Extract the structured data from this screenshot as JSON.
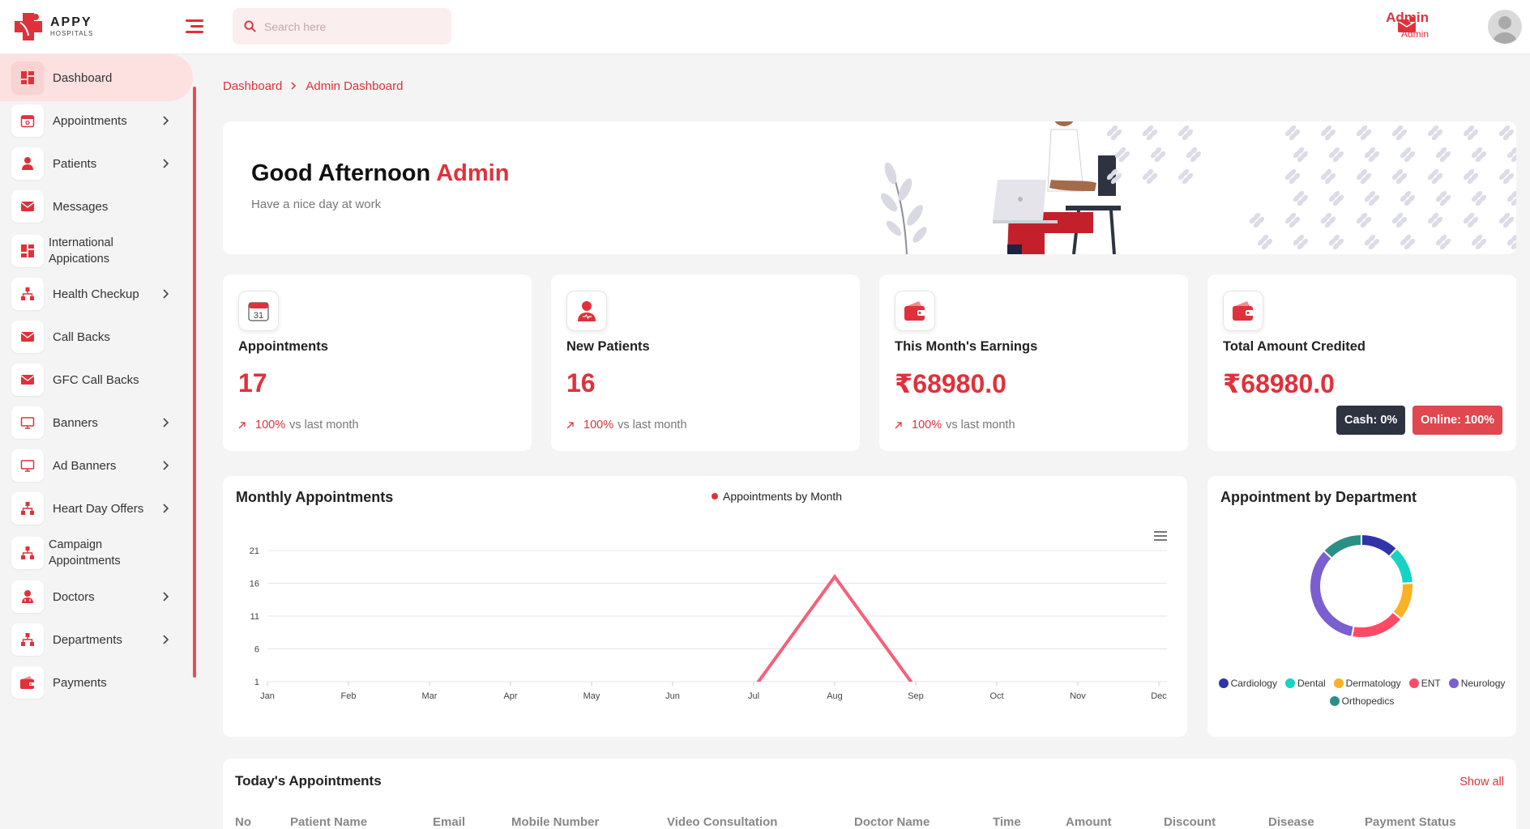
{
  "brand": {
    "name": "APPY",
    "sub": "HOSPITALS",
    "accent": "#e0313a"
  },
  "search": {
    "placeholder": "Search here"
  },
  "user": {
    "name": "Admin",
    "role": "Admin"
  },
  "sidebar": {
    "items": [
      {
        "label": "Dashboard",
        "icon": "dashboard-icon",
        "chevron": false,
        "active": true
      },
      {
        "label": "Appointments",
        "icon": "calendar-icon",
        "chevron": true
      },
      {
        "label": "Patients",
        "icon": "patient-icon",
        "chevron": true
      },
      {
        "label": "Messages",
        "icon": "mail-icon",
        "chevron": false
      },
      {
        "label": "International Appications",
        "icon": "grid-icon",
        "chevron": false
      },
      {
        "label": "Health Checkup",
        "icon": "sitemap-icon",
        "chevron": true
      },
      {
        "label": "Call Backs",
        "icon": "mail-icon",
        "chevron": false
      },
      {
        "label": "GFC Call Backs",
        "icon": "mail-icon",
        "chevron": false
      },
      {
        "label": "Banners",
        "icon": "monitor-icon",
        "chevron": true
      },
      {
        "label": "Ad Banners",
        "icon": "monitor-icon",
        "chevron": true
      },
      {
        "label": "Heart Day Offers",
        "icon": "sitemap-icon",
        "chevron": true
      },
      {
        "label": "Campaign Appointments",
        "icon": "sitemap-icon",
        "chevron": false
      },
      {
        "label": "Doctors",
        "icon": "doctor-icon",
        "chevron": true
      },
      {
        "label": "Departments",
        "icon": "sitemap-icon",
        "chevron": true
      },
      {
        "label": "Payments",
        "icon": "wallet-icon",
        "chevron": false
      }
    ]
  },
  "breadcrumb": {
    "root": "Dashboard",
    "current": "Admin Dashboard"
  },
  "welcome": {
    "greeting": "Good Afternoon",
    "name": "Admin",
    "subtitle": "Have a nice day at work"
  },
  "stats": [
    {
      "title": "Appointments",
      "value": "17",
      "trend_pct": "100%",
      "trend_text": "vs last month",
      "icon": "calendar-icon"
    },
    {
      "title": "New Patients",
      "value": "16",
      "trend_pct": "100%",
      "trend_text": "vs last month",
      "icon": "patient-icon"
    },
    {
      "title": "This Month's Earnings",
      "value": "₹68980.0",
      "trend_pct": "100%",
      "trend_text": "vs last month",
      "icon": "wallet-icon"
    },
    {
      "title": "Total Amount Credited",
      "value": "₹68980.0",
      "cash": "Cash: 0%",
      "online": "Online: 100%",
      "icon": "wallet-icon"
    }
  ],
  "colors": {
    "cash_pill": "#2e3342",
    "online_pill": "#e0474e",
    "line": "#f4617a"
  },
  "monthly": {
    "title": "Monthly Appointments"
  },
  "department": {
    "title": "Appointment by Department"
  },
  "chart_data": [
    {
      "type": "line",
      "title": "Monthly Appointments",
      "x": [
        "Jan",
        "Feb",
        "Mar",
        "Apr",
        "May",
        "Jun",
        "Jul",
        "Aug",
        "Sep",
        "Oct",
        "Nov",
        "Dec"
      ],
      "series": [
        {
          "name": "Appointments by Month",
          "values": [
            0,
            0,
            0,
            0,
            0,
            0,
            0,
            17,
            0,
            0,
            0,
            0
          ]
        }
      ],
      "yticks": [
        1,
        6,
        11,
        16,
        21
      ],
      "ylim": [
        1,
        21
      ],
      "grid": true,
      "legend": "top-center"
    },
    {
      "type": "pie",
      "title": "Appointment by Department",
      "donut": true,
      "categories": [
        "Cardiology",
        "Dental",
        "Dermatology",
        "ENT",
        "Neurology",
        "Orthopedics"
      ],
      "values": [
        12,
        12,
        12,
        17,
        34,
        13
      ],
      "colors": [
        "#2f34a8",
        "#17d3c4",
        "#fbb124",
        "#ff4a66",
        "#7b5fd0",
        "#2c8f86"
      ],
      "legend": "bottom"
    }
  ],
  "today": {
    "title": "Today's Appointments",
    "show_all": "Show all",
    "columns": [
      "No",
      "Patient Name",
      "Email",
      "Mobile Number",
      "Video Consultation",
      "Doctor Name",
      "Time",
      "Amount",
      "Discount",
      "Disease",
      "Payment Status"
    ]
  }
}
